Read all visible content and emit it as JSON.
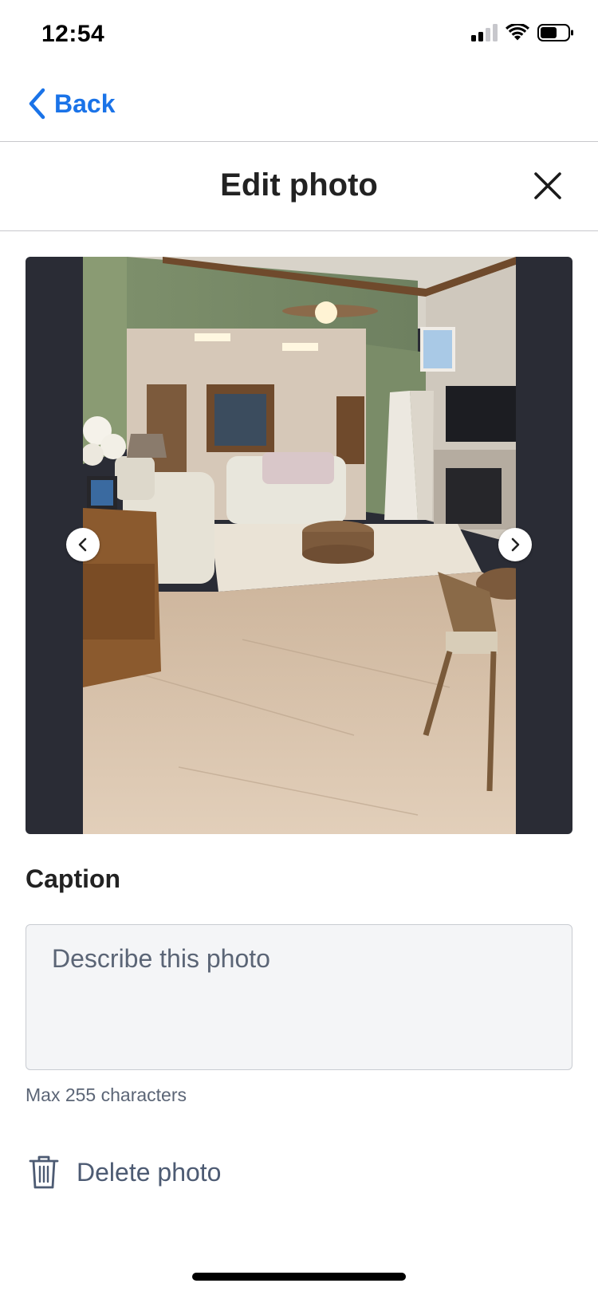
{
  "status_bar": {
    "time": "12:54",
    "signal_icon": "cellular-signal-icon",
    "wifi_icon": "wifi-icon",
    "battery_icon": "battery-icon"
  },
  "nav": {
    "back_label": "Back",
    "back_icon": "chevron-left-icon",
    "accent_color": "#1a73e8"
  },
  "header": {
    "title": "Edit photo",
    "close_icon": "close-icon"
  },
  "photo": {
    "prev_icon": "chevron-left-icon",
    "next_icon": "chevron-right-icon"
  },
  "caption": {
    "label": "Caption",
    "placeholder": "Describe this photo",
    "value": "",
    "helper": "Max 255 characters"
  },
  "delete": {
    "label": "Delete photo",
    "icon": "trash-icon"
  }
}
